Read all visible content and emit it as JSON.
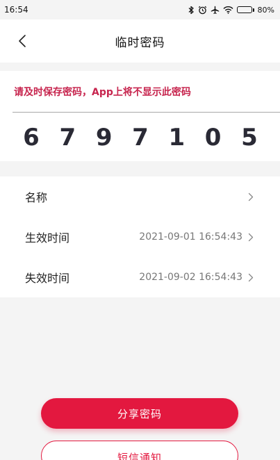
{
  "status_bar": {
    "time": "16:54",
    "battery": "80%",
    "battery_level": 0.8
  },
  "header": {
    "title": "临时密码"
  },
  "code_section": {
    "warning": "请及时保存密码，App上将不显示此密码",
    "digits": [
      "6",
      "7",
      "9",
      "7",
      "1",
      "0",
      "5"
    ]
  },
  "info": {
    "rows": [
      {
        "label": "名称",
        "value": ""
      },
      {
        "label": "生效时间",
        "value": "2021-09-01 16:54:43"
      },
      {
        "label": "失效时间",
        "value": "2021-09-02 16:54:43"
      }
    ]
  },
  "actions": {
    "share_label": "分享密码",
    "sms_label": "短信通知"
  },
  "colors": {
    "accent": "#e3183f",
    "warning": "#c7254e"
  },
  "icons": [
    "bluetooth-icon",
    "alarm-icon",
    "airplane-icon",
    "wifi-icon",
    "battery-icon",
    "back-arrow-icon",
    "chevron-right-icon"
  ]
}
